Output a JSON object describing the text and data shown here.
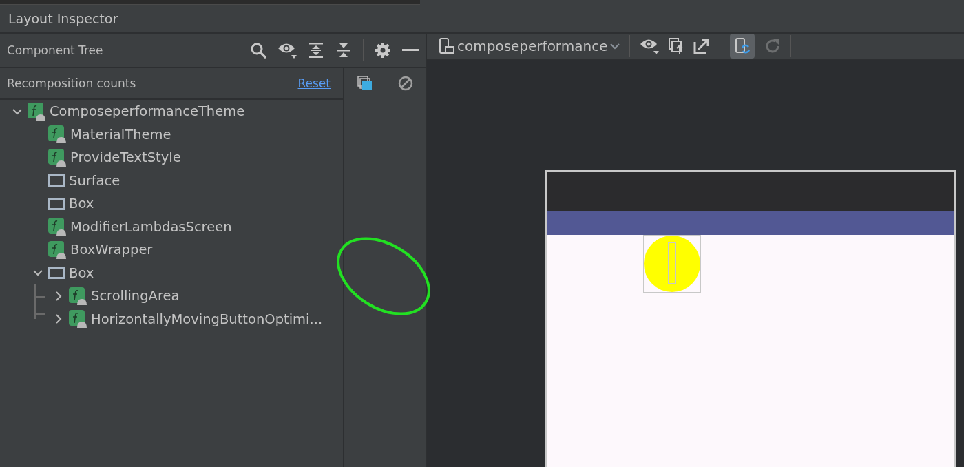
{
  "window": {
    "title": "Layout Inspector"
  },
  "component_tree": {
    "title": "Component Tree",
    "recomposition_label": "Recomposition counts",
    "reset_link": "Reset",
    "nodes": [
      {
        "name": "ComposeperformanceTheme",
        "kind": "composable",
        "expanded": true,
        "children": [
          {
            "name": "MaterialTheme",
            "kind": "composable"
          },
          {
            "name": "ProvideTextStyle",
            "kind": "composable"
          },
          {
            "name": "Surface",
            "kind": "layout"
          },
          {
            "name": "Box",
            "kind": "layout"
          },
          {
            "name": "ModifierLambdasScreen",
            "kind": "composable"
          },
          {
            "name": "BoxWrapper",
            "kind": "composable"
          },
          {
            "name": "Box",
            "kind": "layout",
            "expanded": true,
            "children": [
              {
                "name": "ScrollingArea",
                "kind": "composable",
                "expanded": false
              },
              {
                "name": "HorizontallyMovingButtonOptimi...",
                "kind": "composable",
                "expanded": false
              }
            ]
          }
        ]
      }
    ]
  },
  "preview_toolbar": {
    "device": "composeperformance",
    "live_updates": {
      "on": true
    },
    "refresh": {
      "disabled": true
    }
  }
}
